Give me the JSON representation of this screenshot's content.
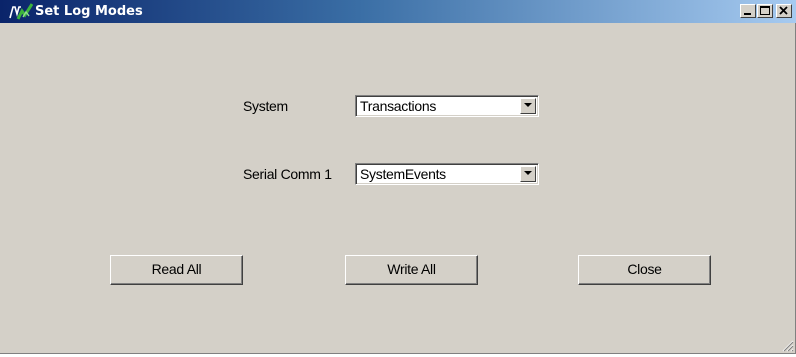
{
  "window": {
    "title": "Set Log Modes",
    "icon": "app-logo-icon",
    "controls": [
      "minimize-icon",
      "maximize-icon",
      "close-icon"
    ]
  },
  "form": {
    "system": {
      "label": "System",
      "selected": "Transactions"
    },
    "serial_comm_1": {
      "label": "Serial Comm 1",
      "selected": "SystemEvents"
    }
  },
  "buttons": {
    "read_all": "Read All",
    "write_all": "Write All",
    "close": "Close"
  },
  "colors": {
    "face": "#d4d0c8",
    "title_start": "#0a246a",
    "title_end": "#a6caf0",
    "icon_green": "#3cb43c"
  }
}
